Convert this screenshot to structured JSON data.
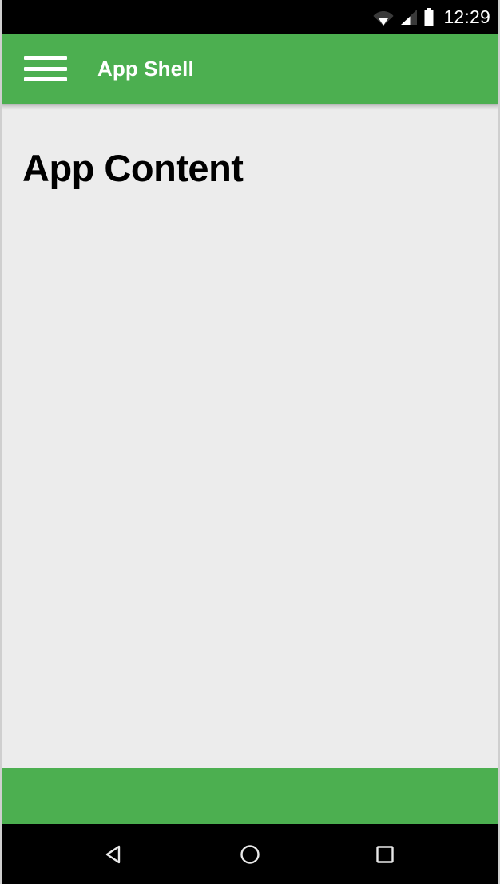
{
  "status_bar": {
    "clock": "12:29",
    "icons": [
      {
        "name": "wifi-icon",
        "label": "wifi"
      },
      {
        "name": "cellular-signal-icon",
        "label": "signal"
      },
      {
        "name": "battery-icon",
        "label": "battery"
      }
    ]
  },
  "app_bar": {
    "menu_icon": "hamburger-menu-icon",
    "title": "App Shell",
    "background_color": "#4CAF50",
    "text_color": "#FFFFFF"
  },
  "main": {
    "heading": "App Content",
    "background_color": "#ECECEC",
    "text_color": "#000000"
  },
  "footer": {
    "background_color": "#4CAF50",
    "label": ""
  },
  "nav_bar": {
    "background_color": "#000000",
    "keys": [
      {
        "name": "nav-back-button",
        "label": "Back"
      },
      {
        "name": "nav-home-button",
        "label": "Home"
      },
      {
        "name": "nav-recents-button",
        "label": "Recents"
      }
    ]
  }
}
